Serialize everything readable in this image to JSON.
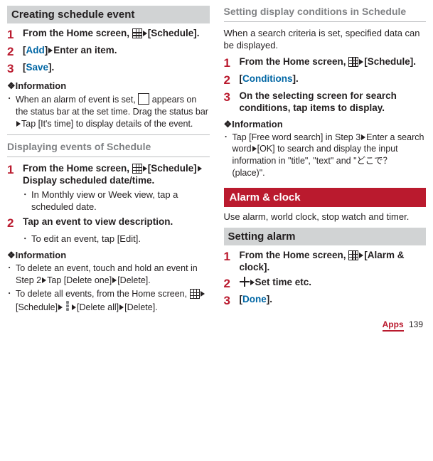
{
  "left": {
    "hd_creating": "Creating schedule event",
    "s1": "From the Home screen, ",
    "s1b": "[Schedule].",
    "s2_pre": "[",
    "s2_add": "Add",
    "s2_post": "]",
    "s2_enter": "Enter an item.",
    "s3_pre": "[",
    "s3_save": "Save",
    "s3_post": "].",
    "info_title": "❖Information",
    "info_a1": "When an alarm of event is set, ",
    "info_a2": " appears on the status bar at the set time. Drag the status bar",
    "info_a3": "Tap [It's time] to display details of the event.",
    "sub_disp": "Displaying events of Schedule",
    "d1": "From the Home screen, ",
    "d1a": "[Schedule]",
    "d1b": "Display scheduled date/time.",
    "d1_sub": "In Monthly view or Week view, tap a scheduled date.",
    "d2": "Tap an event to view description.",
    "d2_sub": "To edit an event, tap [Edit].",
    "info2a": "To delete an event, touch and hold an event in Step 2",
    "info2a2": "Tap [Delete one]",
    "info2a3": "[Delete].",
    "info2b": "To delete all events, from the Home screen, ",
    "info2b2": "[Schedule]",
    "info2b3": "[Delete all]",
    "info2b4": "[Delete]."
  },
  "right": {
    "sub_cond": "Setting display conditions in Schedule",
    "intro": "When a search criteria is set, specified data can be displayed.",
    "c1": "From the Home screen, ",
    "c1b": "[Schedule].",
    "c2_pre": "[",
    "c2": "Conditions",
    "c2_post": "].",
    "c3": "On the selecting screen for search conditions, tap items to display.",
    "info_title": "❖Information",
    "info_c1": "Tap [Free word search] in Step 3",
    "info_c2": "Enter a search word",
    "info_c3": "[OK] to search and display the input information in \"title\", \"text\" and \"どこで？ (place)\".",
    "hd_alarm": "Alarm & clock",
    "alarm_intro": "Use alarm, world clock, stop watch and timer.",
    "hd_setalarm": "Setting alarm",
    "a1": "From the Home screen, ",
    "a1b": "[Alarm & clock].",
    "a2": "Set time etc.",
    "a3_pre": "[",
    "a3": "Done",
    "a3_post": "]."
  },
  "footer": {
    "apps": "Apps",
    "page": "139"
  }
}
